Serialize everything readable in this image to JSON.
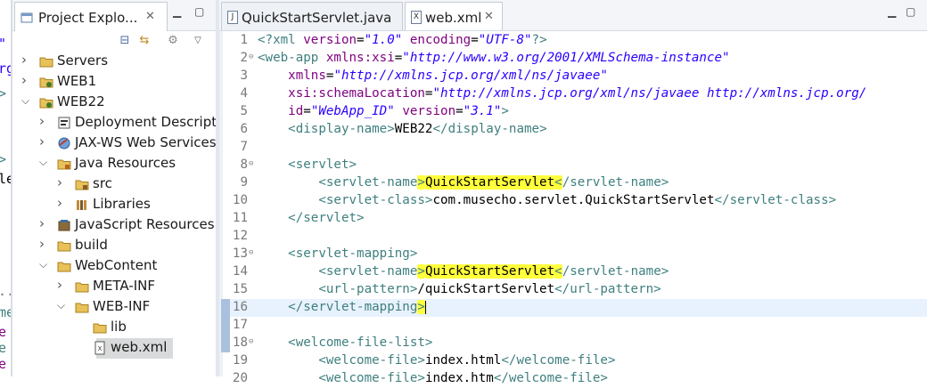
{
  "left_strip": {
    "glyphs": [
      "\"",
      "rg",
      ">",
      ">",
      "le",
      "..",
      "me",
      "e",
      "e",
      "e"
    ]
  },
  "explorer": {
    "tab_title": "Project Explo...",
    "tree": [
      {
        "label": "Servers",
        "expanded": false,
        "icon": "folder-icon"
      },
      {
        "label": "WEB1",
        "expanded": false,
        "icon": "project-icon"
      },
      {
        "label": "WEB22",
        "expanded": true,
        "icon": "project-icon"
      },
      {
        "label": "Deployment Descript",
        "expanded": false,
        "icon": "deployment-descriptor-icon"
      },
      {
        "label": "JAX-WS Web Services",
        "expanded": false,
        "icon": "web-services-icon"
      },
      {
        "label": "Java Resources",
        "expanded": true,
        "icon": "java-resources-icon"
      },
      {
        "label": "src",
        "expanded": false,
        "icon": "package-folder-icon"
      },
      {
        "label": "Libraries",
        "expanded": false,
        "icon": "libraries-icon"
      },
      {
        "label": "JavaScript Resources",
        "expanded": false,
        "icon": "javascript-resources-icon"
      },
      {
        "label": "build",
        "expanded": false,
        "icon": "folder-icon"
      },
      {
        "label": "WebContent",
        "expanded": true,
        "icon": "folder-icon"
      },
      {
        "label": "META-INF",
        "expanded": false,
        "icon": "folder-icon"
      },
      {
        "label": "WEB-INF",
        "expanded": true,
        "icon": "folder-icon"
      },
      {
        "label": "lib",
        "expanded": null,
        "icon": "folder-icon"
      },
      {
        "label": "web.xml",
        "expanded": null,
        "icon": "xml-file-icon",
        "selected": true
      }
    ]
  },
  "editor": {
    "tabs": [
      {
        "label": "QuickStartServlet.java",
        "icon": "java-file-icon",
        "active": false
      },
      {
        "label": "web.xml",
        "icon": "xml-file-icon",
        "active": true
      }
    ],
    "current_line": 16,
    "lines": [
      {
        "n": "1",
        "fold": "",
        "parts": [
          [
            "tag",
            "<?xml "
          ],
          [
            "attr",
            "version"
          ],
          [
            "txt",
            "="
          ],
          [
            "str",
            "\"1.0\""
          ],
          [
            "txt",
            " "
          ],
          [
            "attr",
            "encoding"
          ],
          [
            "txt",
            "="
          ],
          [
            "str",
            "\"UTF-8\""
          ],
          [
            "tag",
            "?>"
          ]
        ]
      },
      {
        "n": "2",
        "fold": "⊖",
        "parts": [
          [
            "tag",
            "<web-app "
          ],
          [
            "attr",
            "xmlns:xsi"
          ],
          [
            "txt",
            "="
          ],
          [
            "str",
            "\"http://www.w3.org/2001/XMLSchema-instance\""
          ]
        ]
      },
      {
        "n": "3",
        "fold": "",
        "parts": [
          [
            "txt",
            "    "
          ],
          [
            "attr",
            "xmlns"
          ],
          [
            "txt",
            "="
          ],
          [
            "str",
            "\"http://xmlns.jcp.org/xml/ns/javaee\""
          ]
        ]
      },
      {
        "n": "4",
        "fold": "",
        "parts": [
          [
            "txt",
            "    "
          ],
          [
            "attr",
            "xsi:schemaLocation"
          ],
          [
            "txt",
            "="
          ],
          [
            "str",
            "\"http://xmlns.jcp.org/xml/ns/javaee http://xmlns.jcp.org/"
          ]
        ]
      },
      {
        "n": "5",
        "fold": "",
        "parts": [
          [
            "txt",
            "    "
          ],
          [
            "attr",
            "id"
          ],
          [
            "txt",
            "="
          ],
          [
            "str",
            "\"WebApp_ID\""
          ],
          [
            "txt",
            " "
          ],
          [
            "attr",
            "version"
          ],
          [
            "txt",
            "="
          ],
          [
            "str",
            "\"3.1\""
          ],
          [
            "tag",
            ">"
          ]
        ]
      },
      {
        "n": "6",
        "fold": "",
        "parts": [
          [
            "txt",
            "    "
          ],
          [
            "tag",
            "<display-name>"
          ],
          [
            "txt",
            "WEB22"
          ],
          [
            "tag",
            "</display-name>"
          ]
        ]
      },
      {
        "n": "7",
        "fold": "",
        "parts": []
      },
      {
        "n": "8",
        "fold": "⊖",
        "parts": [
          [
            "txt",
            "    "
          ],
          [
            "tag",
            "<servlet>"
          ]
        ]
      },
      {
        "n": "9",
        "fold": "",
        "parts": [
          [
            "txt",
            "        "
          ],
          [
            "tag",
            "<servlet-name"
          ],
          [
            "hltag",
            ">"
          ],
          [
            "hl",
            "QuickStartServlet"
          ],
          [
            "hltag",
            "<"
          ],
          [
            "tag",
            "/servlet-name>"
          ]
        ]
      },
      {
        "n": "10",
        "fold": "",
        "parts": [
          [
            "txt",
            "        "
          ],
          [
            "tag",
            "<servlet-class>"
          ],
          [
            "txt",
            "com.musecho.servlet.QuickStartServlet"
          ],
          [
            "tag",
            "</servlet-class>"
          ]
        ]
      },
      {
        "n": "11",
        "fold": "",
        "parts": [
          [
            "txt",
            "    "
          ],
          [
            "tag",
            "</servlet>"
          ]
        ]
      },
      {
        "n": "12",
        "fold": "",
        "parts": []
      },
      {
        "n": "13",
        "fold": "⊖",
        "parts": [
          [
            "txt",
            "    "
          ],
          [
            "tag",
            "<servlet-mapping>"
          ]
        ]
      },
      {
        "n": "14",
        "fold": "",
        "parts": [
          [
            "txt",
            "        "
          ],
          [
            "tag",
            "<servlet-name"
          ],
          [
            "hltag",
            ">"
          ],
          [
            "hl",
            "QuickStartServlet"
          ],
          [
            "hltag",
            "<"
          ],
          [
            "tag",
            "/servlet-name>"
          ]
        ]
      },
      {
        "n": "15",
        "fold": "",
        "parts": [
          [
            "txt",
            "        "
          ],
          [
            "tag",
            "<url-pattern>"
          ],
          [
            "txt",
            "/quickStartServlet"
          ],
          [
            "tag",
            "</url-pattern>"
          ]
        ]
      },
      {
        "n": "16",
        "fold": "",
        "parts": [
          [
            "txt",
            "    "
          ],
          [
            "tag",
            "</servlet-mapping"
          ],
          [
            "hltag",
            ">"
          ],
          [
            "caret",
            ""
          ]
        ]
      },
      {
        "n": "17",
        "fold": "",
        "parts": []
      },
      {
        "n": "18",
        "fold": "⊖",
        "parts": [
          [
            "txt",
            "    "
          ],
          [
            "tag",
            "<welcome-file-list>"
          ]
        ]
      },
      {
        "n": "19",
        "fold": "",
        "parts": [
          [
            "txt",
            "        "
          ],
          [
            "tag",
            "<welcome-file>"
          ],
          [
            "txt",
            "index.html"
          ],
          [
            "tag",
            "</welcome-file>"
          ]
        ]
      },
      {
        "n": "20",
        "fold": "",
        "parts": [
          [
            "txt",
            "        "
          ],
          [
            "tag",
            "<welcome-file>"
          ],
          [
            "txt",
            "index.htm"
          ],
          [
            "tag",
            "</welcome-file>"
          ]
        ]
      }
    ]
  },
  "colors": {
    "tag": "#3f7f7f",
    "attr": "#7f007f",
    "string": "#2a00ff",
    "highlight": "#ffff3c",
    "current_line": "#e8f2fe"
  }
}
